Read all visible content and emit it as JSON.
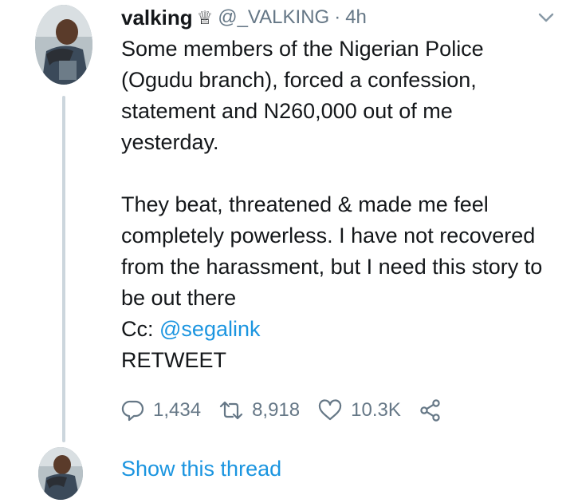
{
  "tweet": {
    "author": {
      "name": "valking",
      "badge": "♕",
      "handle": "@_VALKING",
      "separator": "·",
      "time": "4h"
    },
    "text": {
      "paragraph1": "Some members of the Nigerian Police (Ogudu branch), forced a confession, statement and N260,000 out of me yesterday.",
      "paragraph2": "They beat, threatened & made me feel completely powerless. I have not recovered from the harassment, but I need this story to be out there",
      "cc_prefix": "Cc: ",
      "cc_mention": "@segalink",
      "closing": "RETWEET"
    },
    "stats": {
      "replies": "1,434",
      "retweets": "8,918",
      "likes": "10.3K"
    },
    "icons": [
      "reply-icon",
      "retweet-icon",
      "like-icon",
      "share-icon",
      "chevron-down-icon"
    ],
    "colors": {
      "link": "#1b95e0",
      "secondary_text": "#657786",
      "thread_line": "#ccd6dd"
    }
  },
  "thread": {
    "show_label": "Show this thread"
  }
}
